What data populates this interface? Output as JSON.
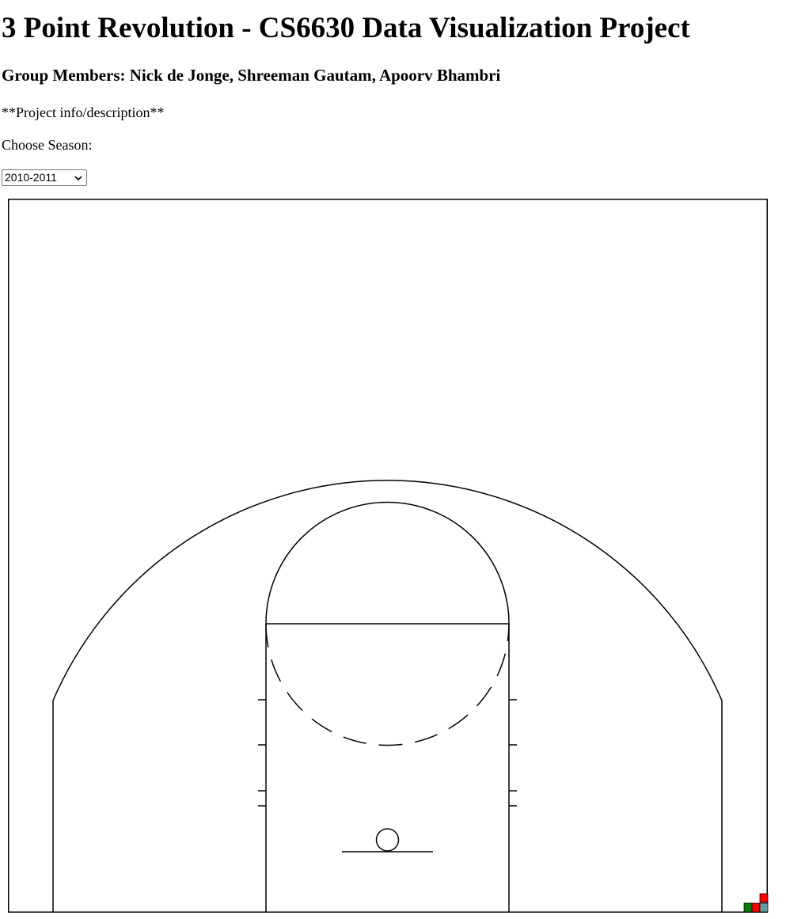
{
  "page": {
    "title": "3 Point Revolution - CS6630 Data Visualization Project",
    "members": "Group Members: Nick de Jonge, Shreeman Gautam, Apoorv Bhambri",
    "description": "**Project info/description**",
    "season_label": "Choose Season:"
  },
  "season_select": {
    "selected": "2010-2011"
  },
  "court": {
    "line_color": "#000000",
    "background": "#ffffff"
  },
  "legend": {
    "colors": [
      "#008000",
      "#ff0000",
      "#ff0000",
      "#5f9ea0"
    ]
  }
}
